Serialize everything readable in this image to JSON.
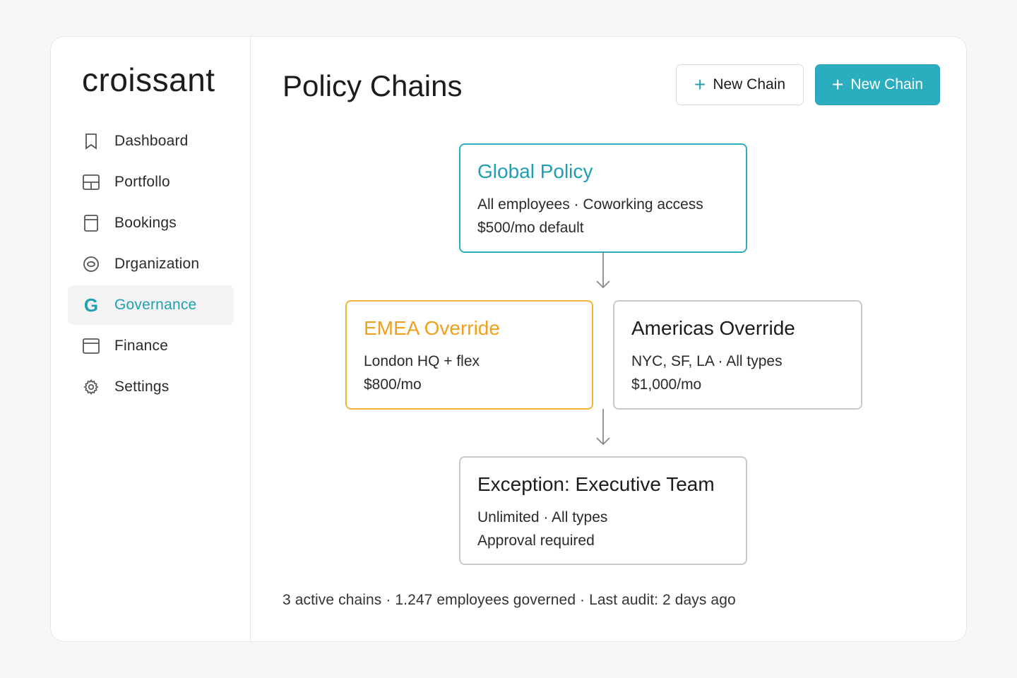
{
  "app": {
    "logo": "croissant"
  },
  "sidebar": {
    "items": [
      {
        "label": "Dashboard",
        "icon": "bookmark-icon"
      },
      {
        "label": "Portfollo",
        "icon": "layout-icon"
      },
      {
        "label": "Bookings",
        "icon": "document-icon"
      },
      {
        "label": "Drganization",
        "icon": "circle-target-icon"
      },
      {
        "label": "Governance",
        "icon": "g-letter-icon",
        "active": true
      },
      {
        "label": "Finance",
        "icon": "window-icon"
      },
      {
        "label": "Settings",
        "icon": "gear-icon"
      }
    ]
  },
  "header": {
    "title": "Policy Chains",
    "new_chain_outline_label": "New Chain",
    "new_chain_primary_label": "New Chain"
  },
  "chain": {
    "global": {
      "title": "Global Policy",
      "line1": "All employees · Coworking access",
      "line2": "$500/mo default"
    },
    "emea": {
      "title": "EMEA Override",
      "line1": "London HQ + flex",
      "line2": "$800/mo"
    },
    "americas": {
      "title": "Americas Override",
      "line1": "NYC, SF, LA · All types",
      "line2": "$1,000/mo"
    },
    "exception": {
      "title": "Exception: Executive Team",
      "line1": "Unlimited · All types",
      "line2": "Approval required"
    }
  },
  "footer": {
    "stats": "3 active chains · 1.247 employees governed · Last audit: 2 days ago"
  },
  "colors": {
    "accent": "#2aaebf",
    "accent_text": "#1e9fb2",
    "emea": "#f5b335",
    "neutral_border": "#c8c8c8"
  }
}
